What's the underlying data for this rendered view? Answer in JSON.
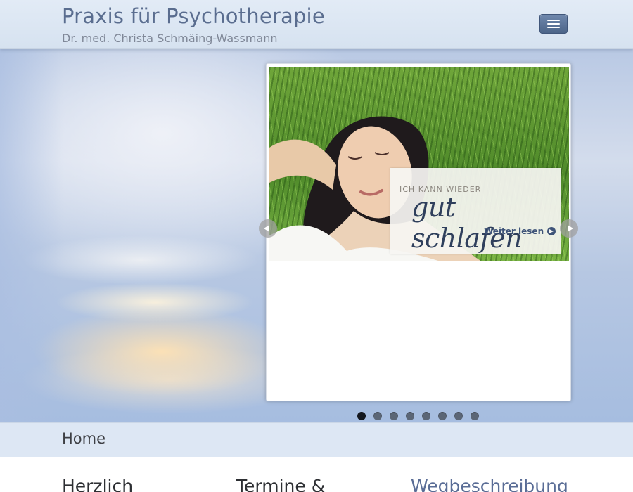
{
  "header": {
    "title": "Praxis für Psychotherapie",
    "subtitle": "Dr. med. Christa Schmäing-Wassmann",
    "menu_icon": "hamburger-menu-icon"
  },
  "slider": {
    "slide_caption_small": "ICH KANN WIEDER",
    "slide_caption_big": "gut schlafen",
    "read_more_label": "Weiter lesen",
    "slide_count": 8,
    "active_slide": 1
  },
  "breadcrumb": {
    "home_label": "Home"
  },
  "content": {
    "columns": [
      {
        "heading": "Herzlich"
      },
      {
        "heading": "Termine &"
      },
      {
        "heading": "Wegbeschreibung"
      }
    ]
  },
  "colors": {
    "accent": "#5a6d8f",
    "menu_button": "#56709a",
    "breadcrumb_bg": "#dde7f4"
  }
}
